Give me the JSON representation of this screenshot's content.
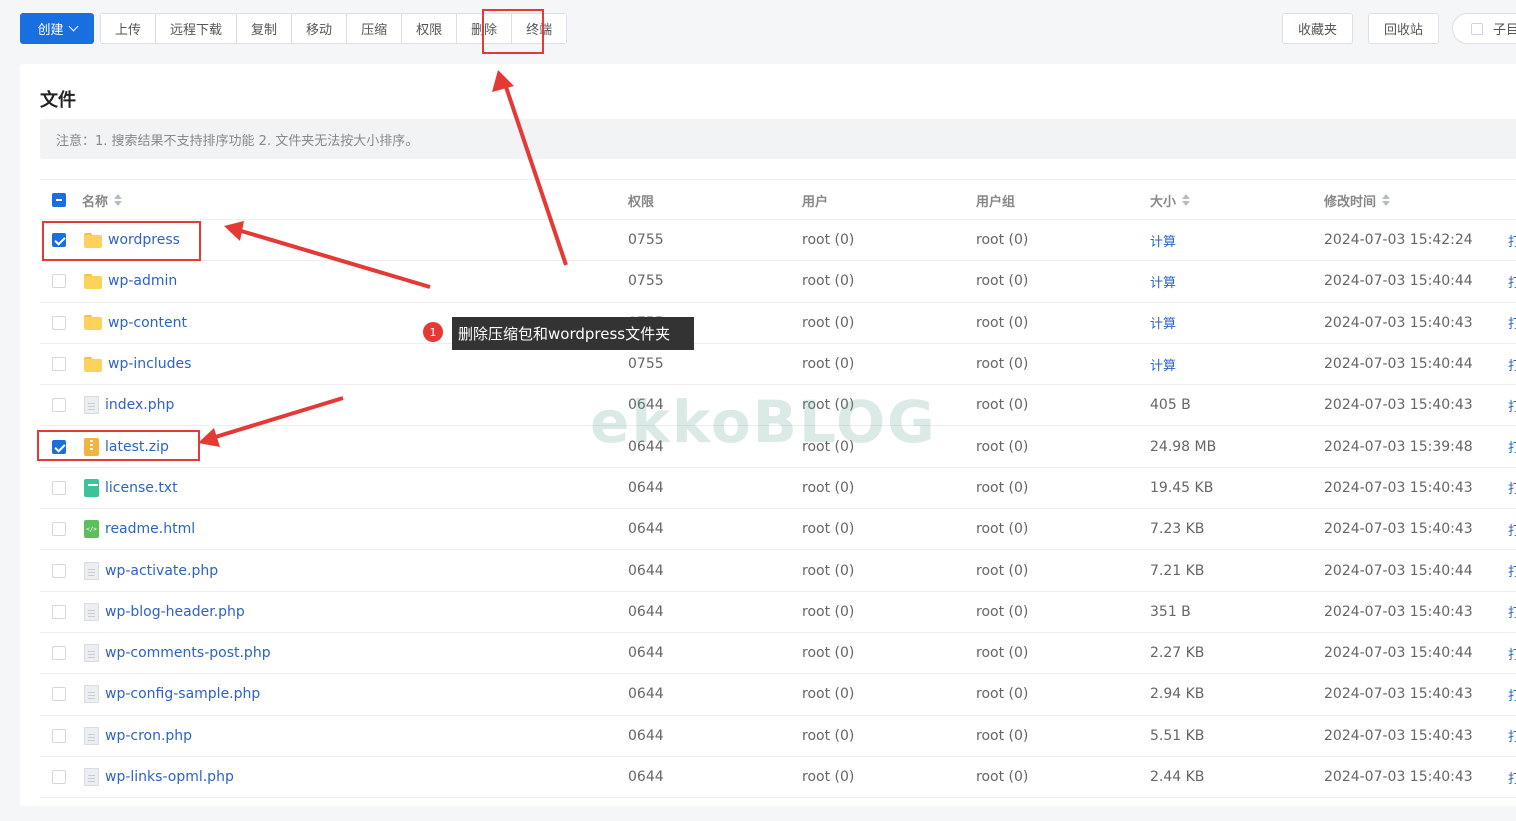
{
  "toolbar": {
    "create_label": "创建",
    "buttons": [
      "上传",
      "远程下载",
      "复制",
      "移动",
      "压缩",
      "权限",
      "删除",
      "终端"
    ],
    "favorites_label": "收藏夹",
    "recycle_label": "回收站",
    "subdir_label": "子目录"
  },
  "panel": {
    "title": "文件",
    "notice": "注意：1. 搜索结果不支持排序功能 2. 文件夹无法按大小排序。"
  },
  "table": {
    "columns": [
      "名称",
      "权限",
      "用户",
      "用户组",
      "大小",
      "修改时间"
    ],
    "calc_label": "计算",
    "op_label": "打",
    "rows": [
      {
        "name": "wordpress",
        "type": "folder",
        "perm": "0755",
        "user": "root (0)",
        "group": "root (0)",
        "size": "",
        "time": "2024-07-03 15:42:24",
        "checked": true
      },
      {
        "name": "wp-admin",
        "type": "folder",
        "perm": "0755",
        "user": "root (0)",
        "group": "root (0)",
        "size": "",
        "time": "2024-07-03 15:40:44",
        "checked": false
      },
      {
        "name": "wp-content",
        "type": "folder",
        "perm": "0755",
        "user": "root (0)",
        "group": "root (0)",
        "size": "",
        "time": "2024-07-03 15:40:43",
        "checked": false
      },
      {
        "name": "wp-includes",
        "type": "folder",
        "perm": "0755",
        "user": "root (0)",
        "group": "root (0)",
        "size": "",
        "time": "2024-07-03 15:40:44",
        "checked": false
      },
      {
        "name": "index.php",
        "type": "file",
        "perm": "0644",
        "user": "root (0)",
        "group": "root (0)",
        "size": "405 B",
        "time": "2024-07-03 15:40:43",
        "checked": false
      },
      {
        "name": "latest.zip",
        "type": "zip",
        "perm": "0644",
        "user": "root (0)",
        "group": "root (0)",
        "size": "24.98 MB",
        "time": "2024-07-03 15:39:48",
        "checked": true
      },
      {
        "name": "license.txt",
        "type": "txt",
        "perm": "0644",
        "user": "root (0)",
        "group": "root (0)",
        "size": "19.45 KB",
        "time": "2024-07-03 15:40:43",
        "checked": false
      },
      {
        "name": "readme.html",
        "type": "html",
        "perm": "0644",
        "user": "root (0)",
        "group": "root (0)",
        "size": "7.23 KB",
        "time": "2024-07-03 15:40:43",
        "checked": false
      },
      {
        "name": "wp-activate.php",
        "type": "file",
        "perm": "0644",
        "user": "root (0)",
        "group": "root (0)",
        "size": "7.21 KB",
        "time": "2024-07-03 15:40:44",
        "checked": false
      },
      {
        "name": "wp-blog-header.php",
        "type": "file",
        "perm": "0644",
        "user": "root (0)",
        "group": "root (0)",
        "size": "351 B",
        "time": "2024-07-03 15:40:43",
        "checked": false
      },
      {
        "name": "wp-comments-post.php",
        "type": "file",
        "perm": "0644",
        "user": "root (0)",
        "group": "root (0)",
        "size": "2.27 KB",
        "time": "2024-07-03 15:40:44",
        "checked": false
      },
      {
        "name": "wp-config-sample.php",
        "type": "file",
        "perm": "0644",
        "user": "root (0)",
        "group": "root (0)",
        "size": "2.94 KB",
        "time": "2024-07-03 15:40:43",
        "checked": false
      },
      {
        "name": "wp-cron.php",
        "type": "file",
        "perm": "0644",
        "user": "root (0)",
        "group": "root (0)",
        "size": "5.51 KB",
        "time": "2024-07-03 15:40:43",
        "checked": false
      },
      {
        "name": "wp-links-opml.php",
        "type": "file",
        "perm": "0644",
        "user": "root (0)",
        "group": "root (0)",
        "size": "2.44 KB",
        "time": "2024-07-03 15:40:43",
        "checked": false
      }
    ]
  },
  "annotation": {
    "badge": "1",
    "tooltip": "删除压缩包和wordpress文件夹",
    "watermark": "ekkoBLOG",
    "color": "#e53935"
  }
}
